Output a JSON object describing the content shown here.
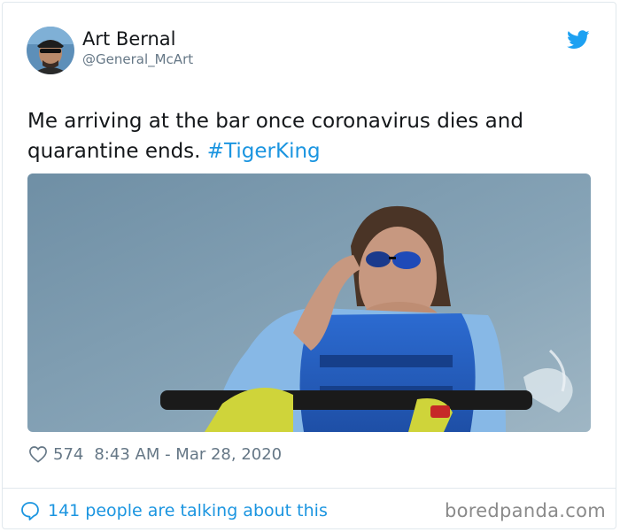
{
  "tweet": {
    "author_name": "Art Bernal",
    "author_handle": "@General_McArt",
    "text": "Me arriving at the bar once coronavirus dies and quarantine ends.",
    "hashtag": "#TigerKing",
    "likes": "574",
    "timestamp": "8:43 AM - Mar 28, 2020",
    "conversation": "141 people are talking about this"
  },
  "icons": {
    "brand": "twitter-bird-icon",
    "like": "heart-icon",
    "reply": "speech-bubble-icon"
  },
  "watermark": "boredpanda.com",
  "colors": {
    "link": "#1b95e0",
    "muted": "#657786",
    "border": "#e1e8ed"
  }
}
